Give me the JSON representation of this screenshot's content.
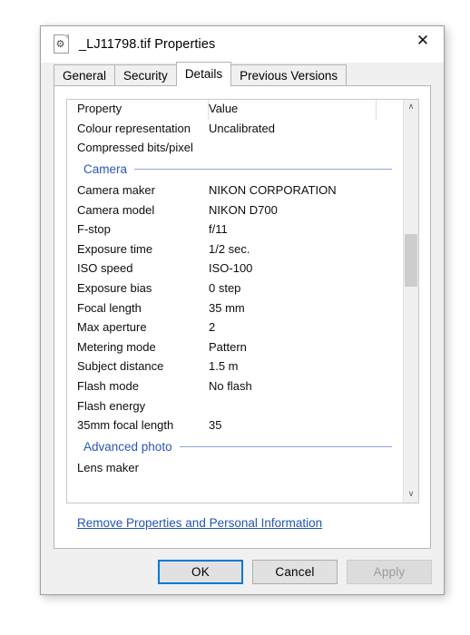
{
  "window": {
    "title": "_LJ11798.tif Properties",
    "icon": "file-document-icon",
    "close_label": "✕"
  },
  "tabs": [
    {
      "label": "General",
      "active": false
    },
    {
      "label": "Security",
      "active": false
    },
    {
      "label": "Details",
      "active": true
    },
    {
      "label": "Previous Versions",
      "active": false
    }
  ],
  "details": {
    "columns": {
      "property": "Property",
      "value": "Value"
    },
    "rows": [
      {
        "type": "item",
        "property": "Colour representation",
        "value": "Uncalibrated"
      },
      {
        "type": "item",
        "property": "Compressed bits/pixel",
        "value": ""
      },
      {
        "type": "group",
        "property": "Camera",
        "value": ""
      },
      {
        "type": "item",
        "property": "Camera maker",
        "value": "NIKON CORPORATION"
      },
      {
        "type": "item",
        "property": "Camera model",
        "value": "NIKON D700"
      },
      {
        "type": "item",
        "property": "F-stop",
        "value": "f/11"
      },
      {
        "type": "item",
        "property": "Exposure time",
        "value": "1/2 sec."
      },
      {
        "type": "item",
        "property": "ISO speed",
        "value": "ISO-100"
      },
      {
        "type": "item",
        "property": "Exposure bias",
        "value": "0 step"
      },
      {
        "type": "item",
        "property": "Focal length",
        "value": "35 mm"
      },
      {
        "type": "item",
        "property": "Max aperture",
        "value": "2"
      },
      {
        "type": "item",
        "property": "Metering mode",
        "value": "Pattern"
      },
      {
        "type": "item",
        "property": "Subject distance",
        "value": "1.5 m"
      },
      {
        "type": "item",
        "property": "Flash mode",
        "value": "No flash"
      },
      {
        "type": "item",
        "property": "Flash energy",
        "value": ""
      },
      {
        "type": "item",
        "property": "35mm focal length",
        "value": "35"
      },
      {
        "type": "group",
        "property": "Advanced photo",
        "value": ""
      },
      {
        "type": "item",
        "property": "Lens maker",
        "value": ""
      }
    ]
  },
  "scrollbar": {
    "up_arrow": "∧",
    "down_arrow": "∨"
  },
  "link": {
    "remove_properties": "Remove Properties and Personal Information"
  },
  "buttons": {
    "ok": "OK",
    "cancel": "Cancel",
    "apply": "Apply"
  },
  "colors": {
    "accent": "#0078d7",
    "group_header": "#2b57b4",
    "link": "#2554b0",
    "dialog_bg": "#f0f0f0"
  }
}
